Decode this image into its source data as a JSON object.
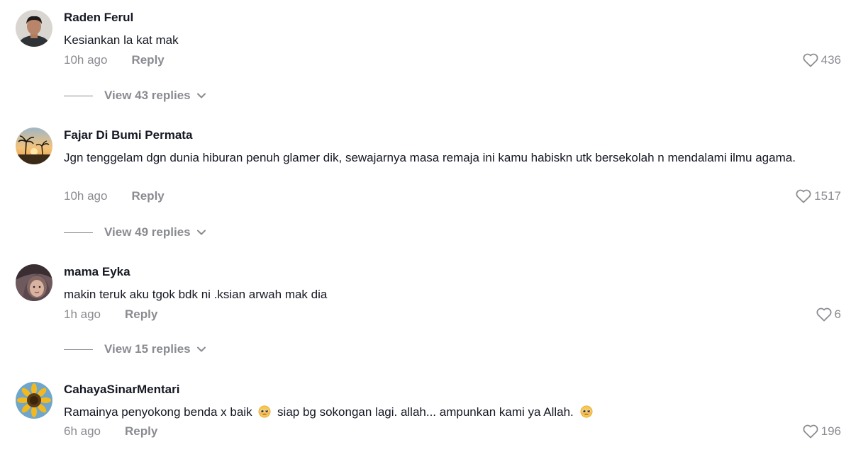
{
  "comments": [
    {
      "username": "Raden Ferul",
      "text": "Kesiankan la kat mak",
      "time": "10h ago",
      "reply_label": "Reply",
      "likes": "436",
      "view_replies": "View 43 replies"
    },
    {
      "username": "Fajar Di Bumi Permata",
      "text": "Jgn tenggelam dgn dunia hiburan penuh glamer dik, sewajarnya masa remaja ini kamu habiskn utk bersekolah n mendalami ilmu agama.",
      "time": "10h ago",
      "reply_label": "Reply",
      "likes": "1517",
      "view_replies": "View 49 replies"
    },
    {
      "username": "mama Eyka",
      "text": "makin teruk aku tgok bdk ni .ksian arwah mak dia",
      "time": "1h ago",
      "reply_label": "Reply",
      "likes": "6",
      "view_replies": "View 15 replies"
    },
    {
      "username": "CahayaSinarMentari",
      "text_part1": "Ramainya penyokong benda x baik",
      "text_part2": "siap bg sokongan lagi. allah... ampunkan kami ya Allah.",
      "time": "6h ago",
      "reply_label": "Reply",
      "likes": "196"
    }
  ],
  "icons": {
    "like": "heart-outline-icon",
    "expand": "chevron-down-icon",
    "emoji": "pleading-face-emoji"
  },
  "colors": {
    "primary_text": "#161823",
    "secondary_text": "#8a8b91",
    "background": "#ffffff"
  }
}
